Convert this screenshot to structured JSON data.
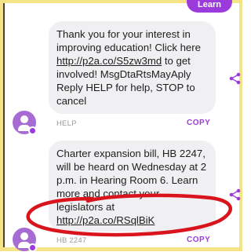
{
  "top_button": {
    "label": "Learn"
  },
  "messages": [
    {
      "text_before_link": "Thank you for your interest in improving education! Click here ",
      "link": "http://p2a.co/S5zw3md",
      "text_after_link": " to get involved! MsgDtaRtsMayAply Reply HELP for help, STOP to cancel"
    },
    {
      "text_before_link": "Charter expansion bill, HB 2247, will be heard on Wednesday at 2 p.m. in Hearing Room 6. Learn more and contact your legislators at ",
      "link": "http://p2a.co/RSqlBiK",
      "text_after_link": ""
    }
  ],
  "replies": [
    {
      "label": "HELP",
      "copy_label": "COPY"
    },
    {
      "label": "HB 2247",
      "copy_label": "COPY"
    }
  ],
  "colors": {
    "accent": "#9c3bdb",
    "bubble": "#f0eff1",
    "frame": "#f4e487",
    "annotation": "#d9141c"
  },
  "icons": [
    "share-icon",
    "avatar-icon"
  ]
}
